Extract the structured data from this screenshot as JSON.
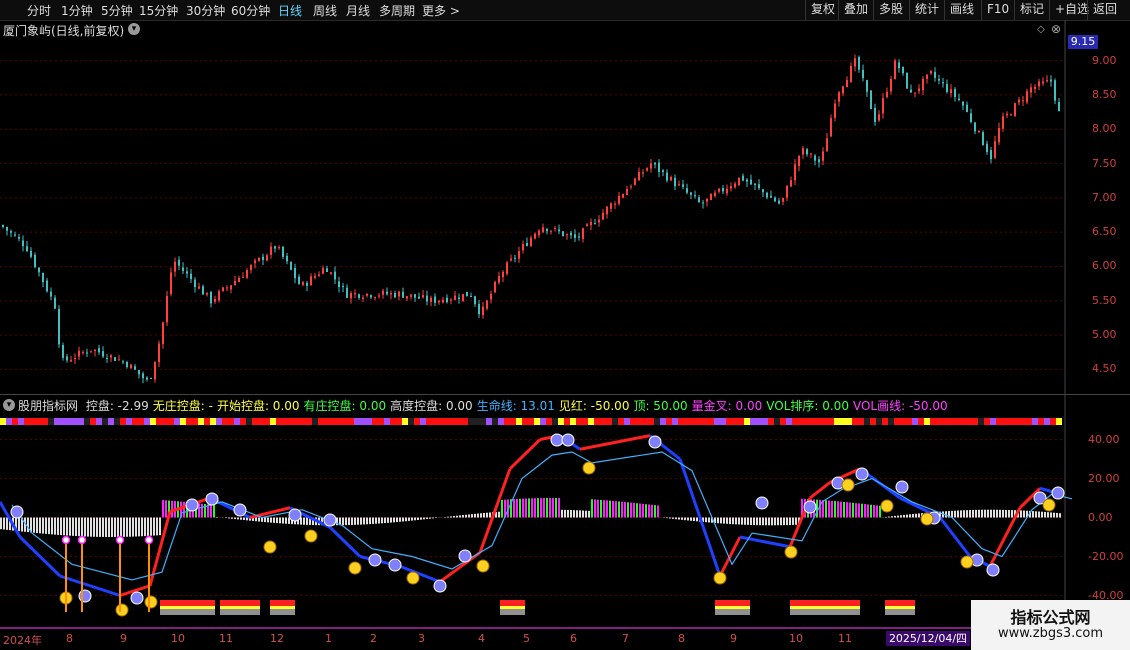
{
  "toolbar": {
    "periods": [
      "分时",
      "1分钟",
      "5分钟",
      "15分钟",
      "30分钟",
      "60分钟",
      "日线",
      "周线",
      "月线",
      "多周期",
      "更多 >"
    ],
    "active_period": "日线",
    "buttons": [
      "复权",
      "叠加",
      "多股",
      "统计",
      "画线",
      "F10",
      "标记",
      "+自选",
      "返回"
    ]
  },
  "stock": {
    "title": "厦门象屿(日线,前复权)",
    "last_price": "9.15"
  },
  "price_axis": {
    "labels": [
      "9.00",
      "8.50",
      "8.00",
      "7.50",
      "7.00",
      "6.50",
      "6.00",
      "5.50",
      "5.00",
      "4.50"
    ],
    "min": 4.2,
    "max": 9.3
  },
  "indicator": {
    "items": [
      {
        "label": "股朋指标网",
        "value": "",
        "color": "#dddddd"
      },
      {
        "label": "控盘:",
        "value": "-2.99",
        "color": "#dddddd"
      },
      {
        "label": "无庄控盘:",
        "value": "-",
        "color": "#ffff40"
      },
      {
        "label": "开始控盘:",
        "value": "0.00",
        "color": "#ffff40"
      },
      {
        "label": "有庄控盘:",
        "value": "0.00",
        "color": "#40ff40"
      },
      {
        "label": "高度控盘:",
        "value": "0.00",
        "color": "#dddddd"
      },
      {
        "label": "生命线:",
        "value": "13.01",
        "color": "#40b0ff"
      },
      {
        "label": "见红:",
        "value": "-50.00",
        "color": "#ffff40"
      },
      {
        "label": "顶:",
        "value": "50.00",
        "color": "#40ff40"
      },
      {
        "label": "量金叉:",
        "value": "0.00",
        "color": "#ff40ff"
      },
      {
        "label": "VOL排序:",
        "value": "0.00",
        "color": "#40ff40"
      },
      {
        "label": "VOL画线:",
        "value": "-50.00",
        "color": "#ff40ff"
      }
    ],
    "axis_labels": [
      "40.00",
      "20.00",
      "0.00",
      "-20.00",
      "-40.00"
    ],
    "min": -50,
    "max": 50
  },
  "time_axis": {
    "year_label": "2024年",
    "months": [
      "8",
      "9",
      "10",
      "11",
      "12",
      "1",
      "2",
      "3",
      "4",
      "5",
      "6",
      "7",
      "8",
      "9",
      "10",
      "11"
    ],
    "cursor_date": "2025/12/04/四"
  },
  "watermark": {
    "line1": "指标公式网",
    "line2": "www.zbgs3.com"
  },
  "colors": {
    "up": "#ff4040",
    "down": "#40c0c0",
    "grid": "#5a0000",
    "lifeline": "#40b0ff"
  }
}
